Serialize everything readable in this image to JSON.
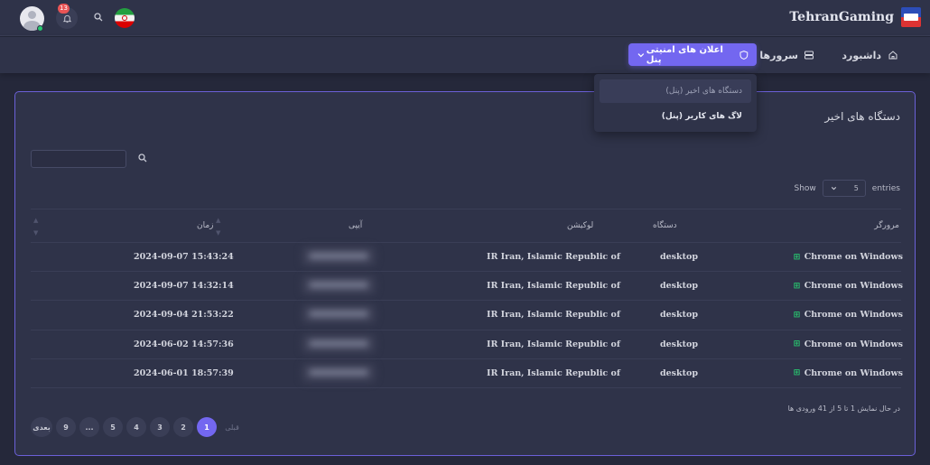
{
  "brand": {
    "name": "TehranGaming"
  },
  "topbar": {
    "notification_count": "13"
  },
  "nav": {
    "dashboard": "داشبورد",
    "servers": "سرورها",
    "servers_badge": "1",
    "security": "اعلان های امنیتی پنل"
  },
  "dropdown": {
    "items": [
      "دستگاه های اخیر (پنل)",
      "لاگ های کاربر (پنل)"
    ]
  },
  "card": {
    "title": "دستگاه های اخیر"
  },
  "length": {
    "show": "Show",
    "value": "5",
    "entries": "entries"
  },
  "table": {
    "headers": {
      "browser": "مرورگر",
      "device": "دستگاه",
      "location": "لوکیشن",
      "ip": "آیپی",
      "time": "زمان"
    },
    "rows": [
      {
        "browser": "Chrome on Windows",
        "device": "desktop",
        "location": "IR Iran, Islamic Republic of",
        "time": "2024-09-07 15:43:24"
      },
      {
        "browser": "Chrome on Windows",
        "device": "desktop",
        "location": "IR Iran, Islamic Republic of",
        "time": "2024-09-07 14:32:14"
      },
      {
        "browser": "Chrome on Windows",
        "device": "desktop",
        "location": "IR Iran, Islamic Republic of",
        "time": "2024-09-04 21:53:22"
      },
      {
        "browser": "Chrome on Windows",
        "device": "desktop",
        "location": "IR Iran, Islamic Republic of",
        "time": "2024-06-02 14:57:36"
      },
      {
        "browser": "Chrome on Windows",
        "device": "desktop",
        "location": "IR Iran, Islamic Republic of",
        "time": "2024-06-01 18:57:39"
      }
    ]
  },
  "footer": {
    "info": "در حال نمایش 1 تا 5 از 41 ورودی ها"
  },
  "pagination": {
    "next": "بعدی",
    "pages": [
      "9",
      "...",
      "5",
      "4",
      "3",
      "2",
      "1"
    ],
    "prev": "قبلی"
  },
  "colors": {
    "accent": "#7367f0",
    "background": "#25283a",
    "card": "#2f3349",
    "success": "#28c76f",
    "danger": "#ea5455"
  }
}
